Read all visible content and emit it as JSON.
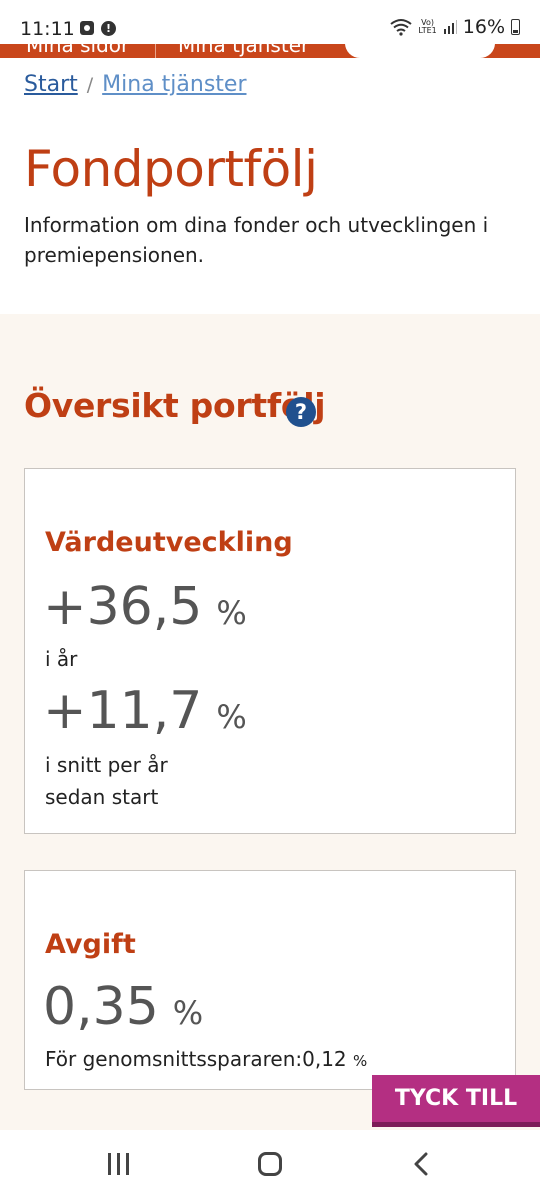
{
  "status_bar": {
    "time": "11:11",
    "network": "LTE1",
    "battery": "16%"
  },
  "top_nav": {
    "items": [
      "Mina sidor",
      "Mina tjänster"
    ]
  },
  "breadcrumb": {
    "home": "Start",
    "separator": "/",
    "current": "Mina tjänster"
  },
  "page": {
    "title": "Fondportfölj",
    "intro": "Information om dina fonder och utvecklingen i premiepensionen."
  },
  "overview": {
    "title": "Översikt portfölj",
    "help_symbol": "?",
    "value_card": {
      "heading": "Värdeutveckling",
      "year_value": "+36,5",
      "year_unit": "%",
      "year_label": "i år",
      "avg_value": "+11,7",
      "avg_unit": "%",
      "avg_label_line1": "i snitt per år",
      "avg_label_line2": "sedan start"
    },
    "fee_card": {
      "heading": "Avgift",
      "value": "0,35",
      "unit": "%",
      "average_label": "För genomsnittsspararen:",
      "average_value": "0,12",
      "average_unit": "%"
    }
  },
  "feedback_button": "TYCK TILL",
  "colors": {
    "accent": "#bf3f14",
    "link": "#2a5b9c",
    "section_bg": "#fbf6f0",
    "feedback": "#b42f82",
    "help": "#20508e"
  }
}
